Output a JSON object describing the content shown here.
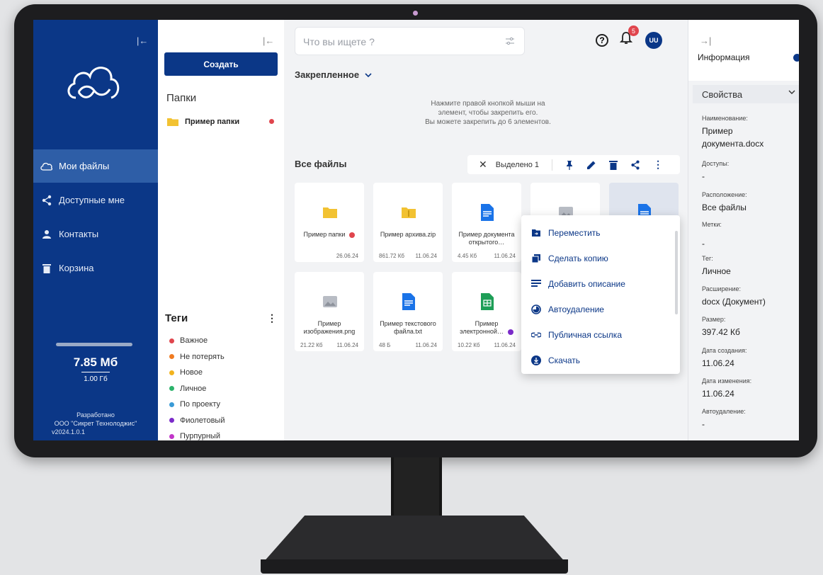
{
  "colors": {
    "brand": "#0b3787",
    "nav_active": "#2e5ea7",
    "badge": "#e0454d"
  },
  "nav": {
    "items": [
      {
        "label": "Мои файлы",
        "icon": "cloud-icon"
      },
      {
        "label": "Доступные мне",
        "icon": "share-icon"
      },
      {
        "label": "Контакты",
        "icon": "person-icon"
      },
      {
        "label": "Корзина",
        "icon": "trash-icon"
      }
    ],
    "storage_used": "7.85 Мб",
    "storage_total": "1.00 Гб",
    "dev_line1": "Разработано",
    "dev_line2": "ООО \"Сикрет Технолоджис\"",
    "dev_line3": "v2024.1.0.1"
  },
  "panel": {
    "create_label": "Создать",
    "folders_title": "Папки",
    "folder": {
      "name": "Пример папки"
    },
    "tags_title": "Теги",
    "tags": [
      {
        "name": "Важное",
        "color": "#e0454d"
      },
      {
        "name": "Не потерять",
        "color": "#f07b21"
      },
      {
        "name": "Новое",
        "color": "#f2b31e"
      },
      {
        "name": "Личное",
        "color": "#2bb36b"
      },
      {
        "name": "По проекту",
        "color": "#3a9bd6"
      },
      {
        "name": "Фиолетовый",
        "color": "#7b2bc9"
      },
      {
        "name": "Пурпурный",
        "color": "#c236c9"
      }
    ]
  },
  "main": {
    "search_placeholder": "Что вы ищете ?",
    "notifications_count": "5",
    "avatar_initials": "UU",
    "pinned_title": "Закрепленное",
    "pinned_hint_1": "Нажмите правой кнопкой мыши на",
    "pinned_hint_2": "элемент, чтобы закрепить его.",
    "pinned_hint_3": "Вы можете закрепить до 6 элементов.",
    "all_files_title": "Все файлы",
    "selected_label": "Выделено 1",
    "files": [
      {
        "name": "Пример папки",
        "size": "",
        "date": "26.06.24",
        "icon": "folder-icon",
        "tag_color": "#e0454d"
      },
      {
        "name": "Пример архива.zip",
        "size": "861.72 Кб",
        "date": "11.06.24",
        "icon": "archive-icon"
      },
      {
        "name": "Пример документа открытого…",
        "size": "4.45 Кб",
        "date": "11.06.24",
        "icon": "document-icon"
      },
      {
        "name": "",
        "size": "",
        "date": "",
        "icon": "image-icon"
      },
      {
        "name": "",
        "size": "",
        "date": "",
        "icon": "document-icon",
        "selected": true
      },
      {
        "name": "Пример изображения.png",
        "size": "21.22 Кб",
        "date": "11.06.24",
        "icon": "image-icon"
      },
      {
        "name": "Пример текстового файла.txt",
        "size": "48 Б",
        "date": "11.06.24",
        "icon": "text-file-icon"
      },
      {
        "name": "Пример электронной…",
        "size": "10.22 Кб",
        "date": "11.06.24",
        "icon": "spreadsheet-icon",
        "tag_color": "#7b2bc9"
      }
    ],
    "context_menu": [
      {
        "label": "Переместить",
        "icon": "move-icon"
      },
      {
        "label": "Сделать копию",
        "icon": "copy-icon"
      },
      {
        "label": "Добавить описание",
        "icon": "description-icon"
      },
      {
        "label": "Автоудаление",
        "icon": "timer-icon"
      },
      {
        "label": "Публичная ссылка",
        "icon": "link-icon"
      },
      {
        "label": "Скачать",
        "icon": "download-icon"
      }
    ]
  },
  "info": {
    "title": "Информация",
    "section": "Свойства",
    "props": [
      {
        "label": "Наименование:",
        "value": "Пример документа.docx"
      },
      {
        "label": "Доступы:",
        "value": "-"
      },
      {
        "label": "Расположение:",
        "value": "Все файлы"
      },
      {
        "label": "Метки:",
        "value": "-"
      },
      {
        "label": "Тег:",
        "value": "Личное"
      },
      {
        "label": "Расширение:",
        "value": "docx (Документ)"
      },
      {
        "label": "Размер:",
        "value": "397.42 Кб"
      },
      {
        "label": "Дата создания:",
        "value": "11.06.24"
      },
      {
        "label": "Дата изменения:",
        "value": "11.06.24"
      },
      {
        "label": "Автоудаление:",
        "value": "-"
      }
    ]
  }
}
